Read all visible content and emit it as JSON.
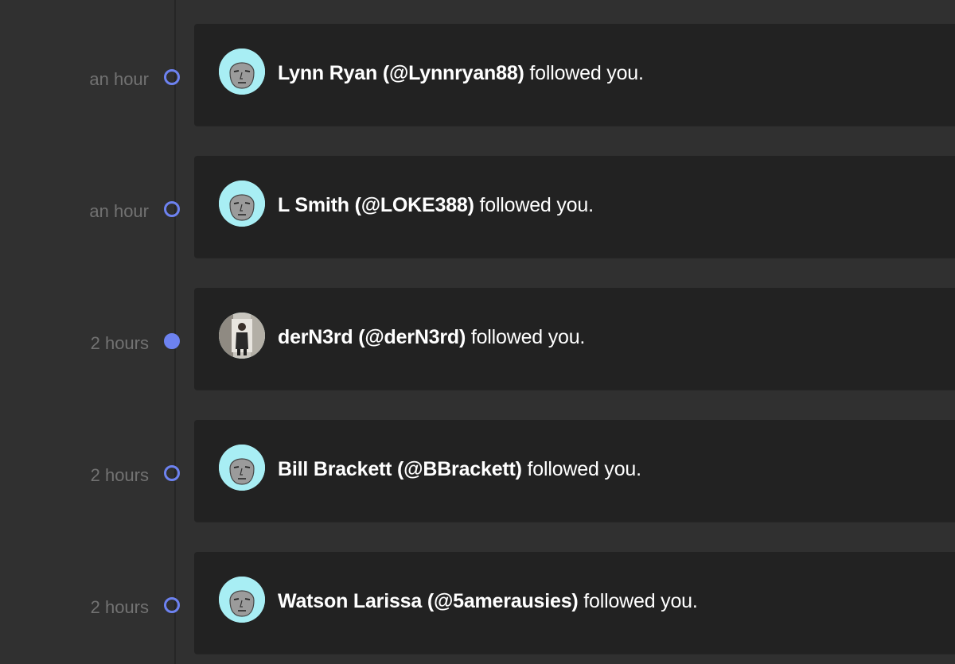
{
  "notifications": [
    {
      "time": "an hour",
      "name": "Lynn Ryan",
      "handle": "(@Lynnryan88)",
      "action": "followed you.",
      "unread": false,
      "avatar": "npc-face-icon"
    },
    {
      "time": "an hour",
      "name": "L Smith",
      "handle": "(@LOKE388)",
      "action": "followed you.",
      "unread": false,
      "avatar": "npc-face-icon"
    },
    {
      "time": "2 hours",
      "name": "derN3rd",
      "handle": "(@derN3rd)",
      "action": "followed you.",
      "unread": true,
      "avatar": "photo-avatar"
    },
    {
      "time": "2 hours",
      "name": "Bill Brackett",
      "handle": "(@BBrackett)",
      "action": "followed you.",
      "unread": false,
      "avatar": "npc-face-icon"
    },
    {
      "time": "2 hours",
      "name": "Watson Larissa",
      "handle": "(@5amerausies)",
      "action": "followed you.",
      "unread": false,
      "avatar": "npc-face-icon"
    }
  ],
  "colors": {
    "background": "#303030",
    "card": "#222222",
    "accent": "#6d82f0",
    "time_text": "#727272",
    "avatar_bg": "#a8eef4"
  }
}
